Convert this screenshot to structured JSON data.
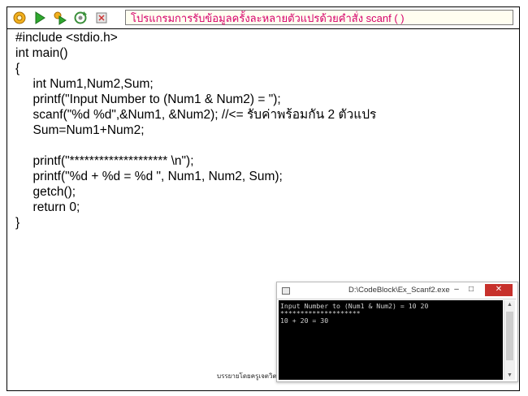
{
  "toolbar": {
    "icons": [
      "gear-icon",
      "run-icon",
      "build-run-icon",
      "rebuild-icon",
      "stop-icon"
    ],
    "title": "โปรแกรมการรับข้อมูลครั้งละหลายตัวแปรด้วยคำสั่ง scanf ( )",
    "title_color": "#d6006b"
  },
  "code_lines": [
    "#include <stdio.h>",
    "int main()",
    "{",
    "     int Num1,Num2,Sum;",
    "     printf(\"Input Number to (Num1 & Num2) = \");",
    "     scanf(\"%d %d\",&Num1, &Num2); //<= รับค่าพร้อมกัน 2 ตัวแปร",
    "     Sum=Num1+Num2;",
    "",
    "     printf(\"******************** \\n\");",
    "     printf(\"%d + %d = %d \", Num1, Num2, Sum);",
    "     getch();",
    "     return 0;",
    "}"
  ],
  "console": {
    "title": "D:\\CodeBlock\\Ex_Scanf2.exe",
    "minimize": "–",
    "maximize": "□",
    "close": "✕",
    "output_lines": [
      "Input Number to (Num1 & Num2) = 10 20",
      "********************",
      "10 + 20 = 30"
    ],
    "close_color": "#c7312c"
  },
  "credit": "บรรยายโดยครูเจตวิตร บุญศิลานิจ"
}
